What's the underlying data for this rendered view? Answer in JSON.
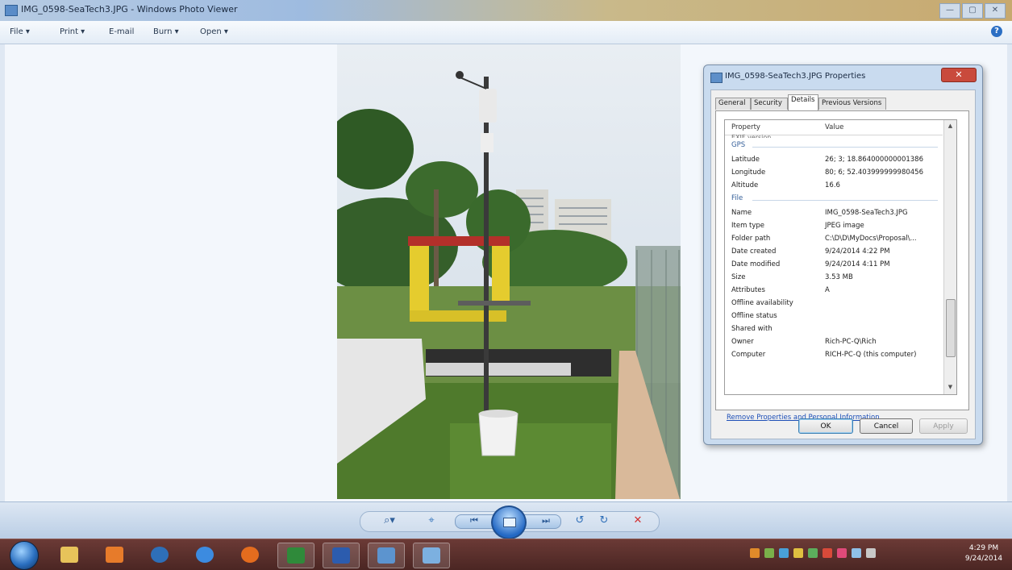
{
  "window": {
    "title": "IMG_0598-SeaTech3.JPG - Windows Photo Viewer",
    "buttons": [
      "—",
      "▢",
      "✕"
    ]
  },
  "menubar": {
    "file": "File ▾",
    "print": "Print ▾",
    "email": "E-mail",
    "burn": "Burn ▾",
    "open": "Open ▾",
    "help": "?"
  },
  "dialog": {
    "title": "IMG_0598-SeaTech3.JPG Properties",
    "close": "✕",
    "tabs": [
      "General",
      "Security",
      "Details",
      "Previous Versions"
    ],
    "active_tab": "Details",
    "columns": {
      "property": "Property",
      "value": "Value"
    },
    "cut_row": "EXIF version",
    "groups": {
      "gps": "GPS",
      "file": "File"
    },
    "gps_rows": [
      {
        "k": "Latitude",
        "v": "26; 3; 18.864000000001386"
      },
      {
        "k": "Longitude",
        "v": "80; 6; 52.403999999980456"
      },
      {
        "k": "Altitude",
        "v": "16.6"
      }
    ],
    "file_rows": [
      {
        "k": "Name",
        "v": "IMG_0598-SeaTech3.JPG"
      },
      {
        "k": "Item type",
        "v": "JPEG image"
      },
      {
        "k": "Folder path",
        "v": "C:\\D\\D\\MyDocs\\Proposal\\..."
      },
      {
        "k": "Date created",
        "v": "9/24/2014 4:22 PM"
      },
      {
        "k": "Date modified",
        "v": "9/24/2014 4:11 PM"
      },
      {
        "k": "Size",
        "v": "3.53 MB"
      },
      {
        "k": "Attributes",
        "v": "A"
      },
      {
        "k": "Offline availability",
        "v": ""
      },
      {
        "k": "Offline status",
        "v": ""
      },
      {
        "k": "Shared with",
        "v": ""
      },
      {
        "k": "Owner",
        "v": "Rich-PC-Q\\Rich"
      },
      {
        "k": "Computer",
        "v": "RICH-PC-Q (this computer)"
      }
    ],
    "remove_link": "Remove Properties and Personal Information",
    "ok": "OK",
    "cancel": "Cancel",
    "apply": "Apply"
  },
  "controls": {
    "zoom": "⌕▾",
    "actual_size": "⌖",
    "previous": "⏮",
    "next": "⏭",
    "rotate_ccw": "↺",
    "rotate_cw": "↻",
    "delete": "✕"
  },
  "taskbar": {
    "time": "4:29 PM",
    "date": "9/24/2014"
  }
}
